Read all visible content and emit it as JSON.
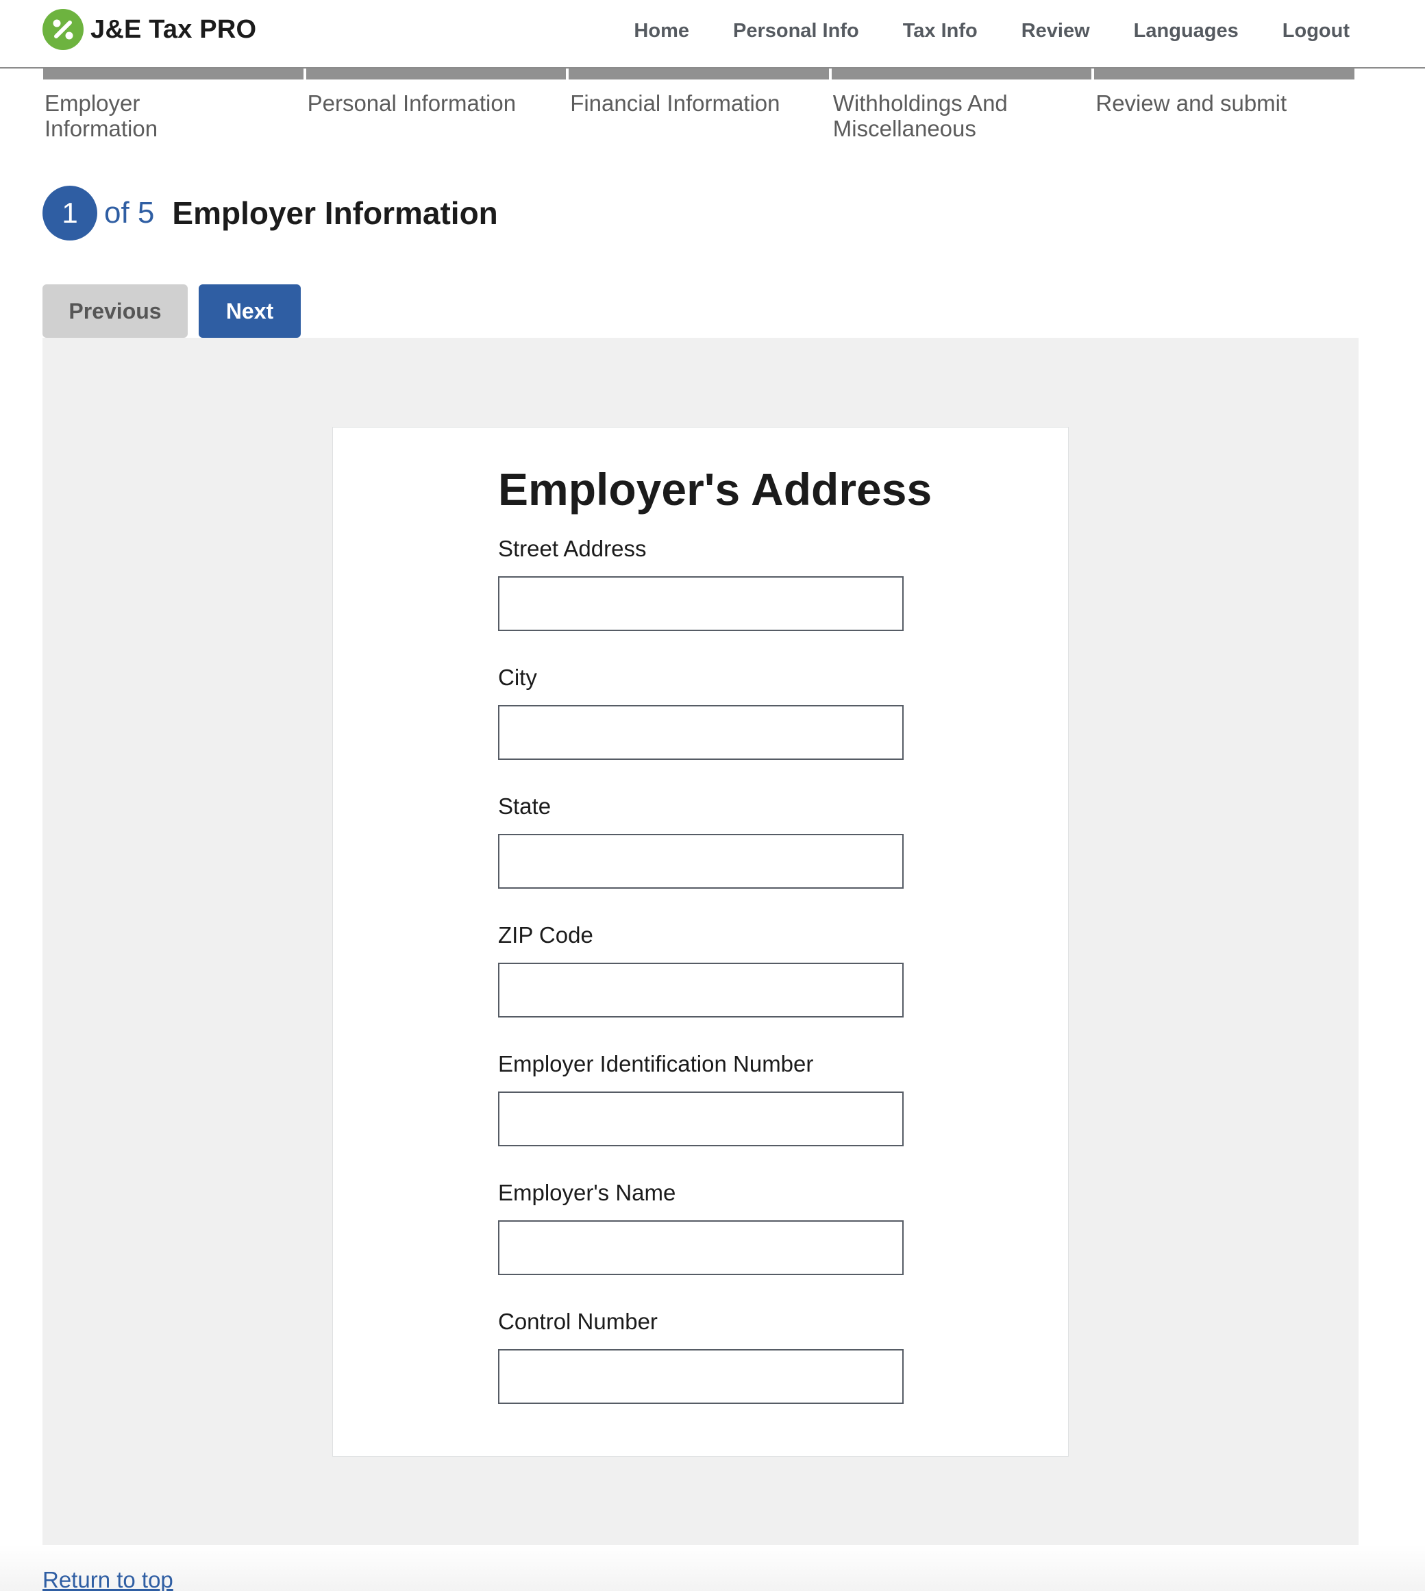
{
  "header": {
    "brand_name": "J&E Tax PRO",
    "logo_icon": "percent-icon",
    "brand_color": "#6db33f",
    "nav": [
      {
        "label": "Home"
      },
      {
        "label": "Personal Info"
      },
      {
        "label": "Tax Info"
      },
      {
        "label": "Review"
      },
      {
        "label": "Languages"
      },
      {
        "label": "Logout"
      }
    ]
  },
  "steps": [
    {
      "label": "Employer Information"
    },
    {
      "label": "Personal Information"
    },
    {
      "label": "Financial Information"
    },
    {
      "label": "Withholdings And Miscellaneous"
    },
    {
      "label": "Review and submit"
    }
  ],
  "step_heading": {
    "current": "1",
    "of_total": "of 5",
    "title": "Employer Information",
    "accent_color": "#2f5ea3"
  },
  "buttons": {
    "previous": "Previous",
    "next": "Next"
  },
  "form": {
    "title": "Employer's Address",
    "fields": [
      {
        "label": "Street Address",
        "value": ""
      },
      {
        "label": "City",
        "value": ""
      },
      {
        "label": "State",
        "value": ""
      },
      {
        "label": "ZIP Code",
        "value": ""
      },
      {
        "label": "Employer Identification Number",
        "value": ""
      },
      {
        "label": "Employer's Name",
        "value": ""
      },
      {
        "label": "Control Number",
        "value": ""
      }
    ]
  },
  "footer": {
    "return_to_top": "Return to top"
  }
}
